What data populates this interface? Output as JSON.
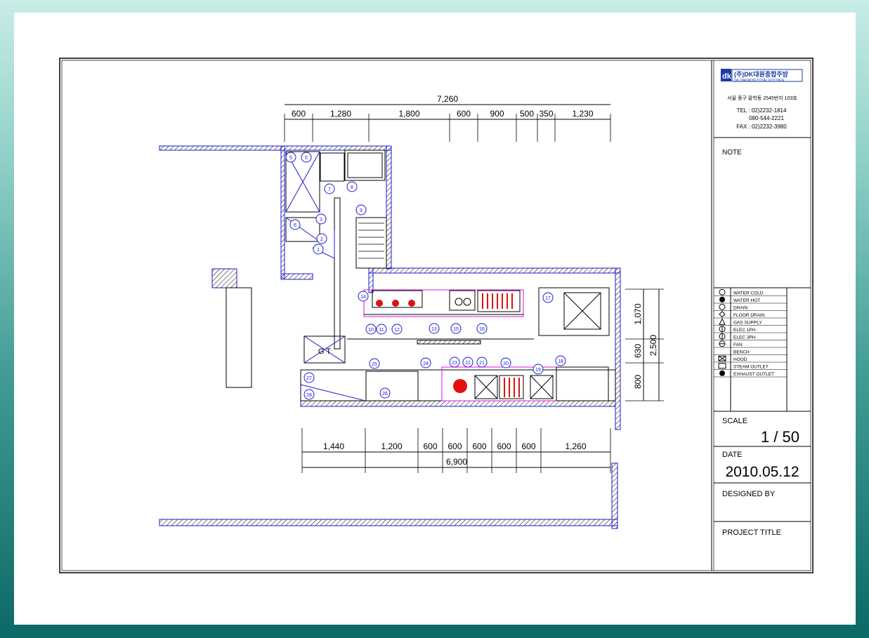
{
  "top_dims": {
    "total": "7,260",
    "segments": [
      "600",
      "1,280",
      "1,800",
      "600",
      "900",
      "500",
      "350",
      "1,230"
    ]
  },
  "bottom_dims": {
    "total": "6,900",
    "segments": [
      "1,440",
      "1,200",
      "600",
      "600",
      "600",
      "600",
      "600",
      "1,260"
    ]
  },
  "right_dims": {
    "total": "2,500",
    "segments": [
      "1,070",
      "630",
      "800"
    ]
  },
  "title_block": {
    "company_kr": "(주)DK대원종합주방",
    "company_en": "DK DAEWON TOTAL KITCHEN",
    "address": "서울 중구 황학동 2545번지 103호",
    "tel_label": "TEL : 02)2232-1814",
    "tel2": "080-544-2221",
    "fax_label": "FAX : 02)2232-3980",
    "note_label": "NOTE",
    "scale_label": "SCALE",
    "scale_value": "1 / 50",
    "date_label": "DATE",
    "date_value": "2010.05.12",
    "designed_label": "DESIGNED BY",
    "project_label": "PROJECT TITLE"
  },
  "legend": [
    {
      "symbol": "circle",
      "label": "WATER COLD"
    },
    {
      "symbol": "gas-valve",
      "label": "WATER HOT"
    },
    {
      "symbol": "circle",
      "label": "DRAIN"
    },
    {
      "symbol": "diamond",
      "label": "FLOOR DRAIN"
    },
    {
      "symbol": "triangle",
      "label": "GAS SUPPLY"
    },
    {
      "symbol": "circle-bar",
      "label": "ELEC 1PH"
    },
    {
      "symbol": "circle-bar",
      "label": "ELEC 3PH"
    },
    {
      "symbol": "circle-line",
      "label": "FAN"
    },
    {
      "symbol": "none",
      "label": "BENCH"
    },
    {
      "symbol": "box-x",
      "label": "HOOD"
    },
    {
      "symbol": "box-h",
      "label": "STEAM OUTLET"
    },
    {
      "symbol": "filled",
      "label": "EXHAUST OUTLET"
    }
  ],
  "plan_labels": {
    "gt": "G T"
  },
  "item_numbers": [
    "1",
    "2",
    "3",
    "5",
    "5",
    "6",
    "7",
    "8",
    "9",
    "10",
    "11",
    "12",
    "13",
    "14",
    "15",
    "16",
    "17",
    "18",
    "19",
    "20",
    "21",
    "22",
    "23",
    "24",
    "25",
    "26",
    "27",
    "28"
  ],
  "colors": {
    "wall": "#1a1ad6",
    "equipment": "#000000",
    "utility": "#e01010",
    "zone": "#e010e0",
    "dimension": "#000000"
  }
}
